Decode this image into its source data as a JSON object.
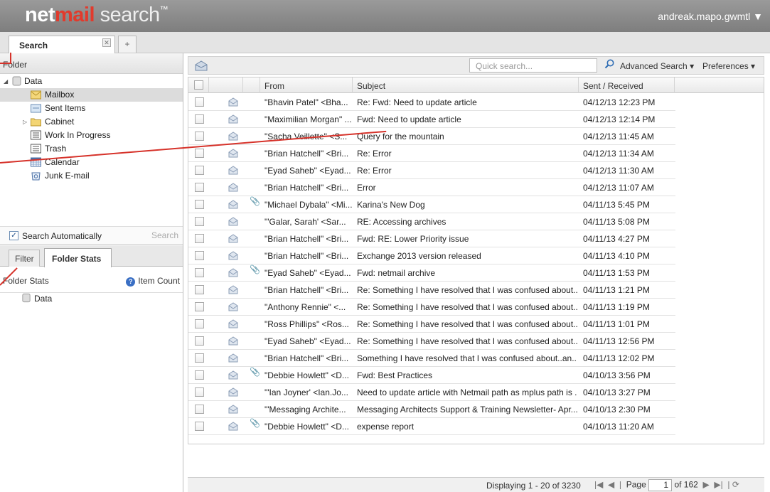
{
  "header": {
    "brand_a": "net",
    "brand_b": "mail",
    "brand_c": " search",
    "brand_tm": "™",
    "user": "andreak.mapo.gwmtl ▼"
  },
  "tabs": {
    "search_label": "Search",
    "close": "✕",
    "add": "+"
  },
  "folder_panel": {
    "title": "Folder",
    "items": [
      {
        "label": "Data",
        "icon": "database-icon"
      },
      {
        "label": "Mailbox",
        "icon": "mailbox-icon"
      },
      {
        "label": "Sent Items",
        "icon": "sent-icon"
      },
      {
        "label": "Cabinet",
        "icon": "folder-icon"
      },
      {
        "label": "Work In Progress",
        "icon": "list-icon"
      },
      {
        "label": "Trash",
        "icon": "trash-icon"
      },
      {
        "label": "Calendar",
        "icon": "calendar-icon"
      },
      {
        "label": "Junk E-mail",
        "icon": "junk-icon"
      }
    ],
    "search_auto": "Search Automatically",
    "search_btn": "Search"
  },
  "lower_tabs": {
    "filter": "Filter",
    "folder_stats": "Folder Stats"
  },
  "folder_stats": {
    "title": "Folder Stats",
    "item_count": "Item Count",
    "data": "Data"
  },
  "toolbar": {
    "quick_placeholder": "Quick search...",
    "advanced": "Advanced Search ▾",
    "preferences": "Preferences ▾"
  },
  "columns": {
    "from": "From",
    "subject": "Subject",
    "sent": "Sent / Received"
  },
  "rows": [
    {
      "from": "\"Bhavin Patel\" <Bha...",
      "subject": "Re: Fwd: Need to update article",
      "date": "04/12/13 12:23 PM",
      "attach": ""
    },
    {
      "from": "\"Maximilian Morgan\" ...",
      "subject": "Fwd: Need to update article",
      "date": "04/12/13 12:14 PM",
      "attach": ""
    },
    {
      "from": "\"Sacha Veillette\" <S...",
      "subject": "Query for the mountain",
      "date": "04/12/13 11:45 AM",
      "attach": ""
    },
    {
      "from": "\"Brian Hatchell\" <Bri...",
      "subject": "Re: Error",
      "date": "04/12/13 11:34 AM",
      "attach": ""
    },
    {
      "from": "\"Eyad Saheb\" <Eyad...",
      "subject": "Re: Error",
      "date": "04/12/13 11:30 AM",
      "attach": ""
    },
    {
      "from": "\"Brian Hatchell\" <Bri...",
      "subject": "Error",
      "date": "04/12/13 11:07 AM",
      "attach": ""
    },
    {
      "from": "\"Michael Dybala\" <Mi...",
      "subject": "Karina's New Dog",
      "date": "04/11/13 5:45 PM",
      "attach": "📎"
    },
    {
      "from": "\"'Galar, Sarah' <Sar...",
      "subject": "RE: Accessing archives",
      "date": "04/11/13 5:08 PM",
      "attach": ""
    },
    {
      "from": "\"Brian Hatchell\" <Bri...",
      "subject": "Fwd: RE: Lower Priority issue",
      "date": "04/11/13 4:27 PM",
      "attach": ""
    },
    {
      "from": "\"Brian Hatchell\" <Bri...",
      "subject": "Exchange 2013 version released",
      "date": "04/11/13 4:10 PM",
      "attach": ""
    },
    {
      "from": "\"Eyad Saheb\" <Eyad...",
      "subject": "Fwd: netmail archive",
      "date": "04/11/13 1:53 PM",
      "attach": "📎"
    },
    {
      "from": "\"Brian Hatchell\" <Bri...",
      "subject": "Re: Something I have resolved that I was confused about....",
      "date": "04/11/13 1:21 PM",
      "attach": ""
    },
    {
      "from": "\"Anthony Rennie\" <...",
      "subject": "Re: Something I have resolved that I was confused about....",
      "date": "04/11/13 1:19 PM",
      "attach": ""
    },
    {
      "from": "\"Ross Phillips\" <Ros...",
      "subject": "Re: Something I have resolved that I was confused about....",
      "date": "04/11/13 1:01 PM",
      "attach": ""
    },
    {
      "from": "\"Eyad Saheb\" <Eyad...",
      "subject": "Re: Something I have resolved that I was confused about....",
      "date": "04/11/13 12:56 PM",
      "attach": ""
    },
    {
      "from": "\"Brian Hatchell\" <Bri...",
      "subject": "Something I have resolved that I was confused about..an...",
      "date": "04/11/13 12:02 PM",
      "attach": ""
    },
    {
      "from": "\"Debbie Howlett\" <D...",
      "subject": "Fwd: Best Practices",
      "date": "04/10/13 3:56 PM",
      "attach": "📎"
    },
    {
      "from": "\"'Ian Joyner' <Ian.Jo...",
      "subject": "Need to update article with Netmail path as mplus path is ...",
      "date": "04/10/13 3:27 PM",
      "attach": ""
    },
    {
      "from": "\"'Messaging Archite...",
      "subject": "Messaging Architects Support & Training Newsletter- Apr...",
      "date": "04/10/13 2:30 PM",
      "attach": ""
    },
    {
      "from": "\"Debbie Howlett\" <D...",
      "subject": "expense report",
      "date": "04/10/13 11:20 AM",
      "attach": "📎"
    }
  ],
  "status": {
    "displaying": "Displaying 1 - 20 of 3230",
    "page_label": "Page",
    "page": "1",
    "of": "of 162"
  },
  "colors": {
    "accent_red": "#e23a2c",
    "header_gray": "#8a8a8a",
    "annotation_red": "#d6322a"
  }
}
